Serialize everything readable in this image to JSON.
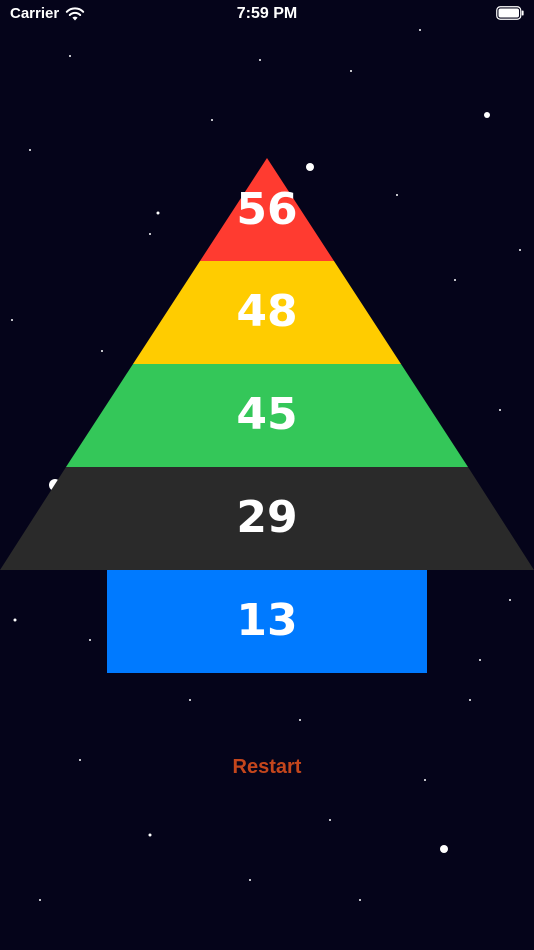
{
  "status_bar": {
    "carrier": "Carrier",
    "time": "7:59 PM",
    "icons": [
      "wifi-icon",
      "battery-icon"
    ]
  },
  "pyramid": {
    "layers": [
      {
        "value": "56",
        "color": "#ff3b30"
      },
      {
        "value": "48",
        "color": "#ffcc00"
      },
      {
        "value": "45",
        "color": "#34c759"
      },
      {
        "value": "29",
        "color": "#2a2a2a"
      },
      {
        "value": "13",
        "color": "#007aff"
      }
    ]
  },
  "restart": {
    "label": "Restart",
    "color": "#c4461c"
  },
  "background_color": "#05041a"
}
